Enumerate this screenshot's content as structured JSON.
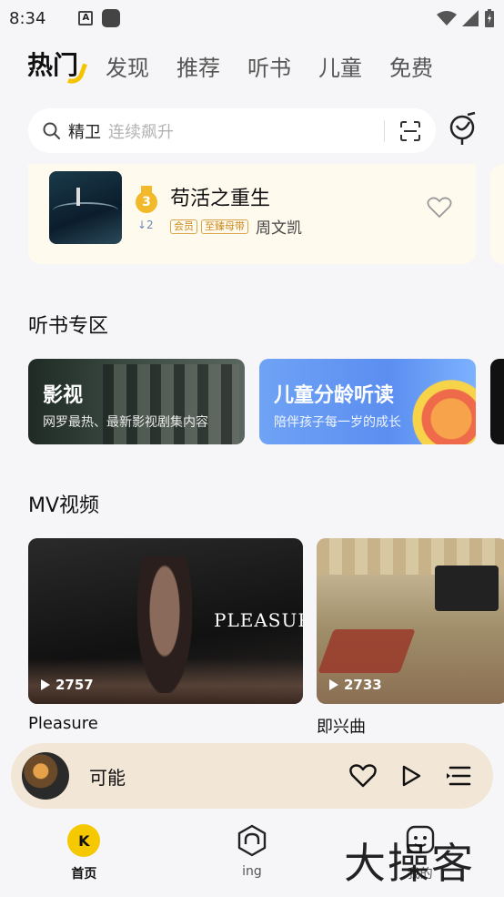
{
  "status_bar": {
    "time": "8:34",
    "notif_icon_a": "A"
  },
  "tabs": [
    "热门",
    "发现",
    "推荐",
    "听书",
    "儿童",
    "免费"
  ],
  "search": {
    "query": "精卫",
    "hint": "连续飙升"
  },
  "top_item": {
    "rank": "3",
    "rank_change": "↓2",
    "title": "苟活之重生",
    "tags": [
      "会员",
      "至臻母带"
    ],
    "author": "周文凯"
  },
  "audiobook_section": {
    "title": "听书专区",
    "cards": [
      {
        "title": "影视",
        "subtitle": "网罗最热、最新影视剧集内容"
      },
      {
        "title": "儿童分龄听读",
        "subtitle": "陪伴孩子每一岁的成长"
      }
    ]
  },
  "mv_section": {
    "title": "MV视频",
    "items": [
      {
        "title": "Pleasure",
        "plays": "2757",
        "logo": "PLEASURE"
      },
      {
        "title": "即兴曲",
        "plays": "2733"
      }
    ]
  },
  "mini_player": {
    "title": "可能"
  },
  "bottom_nav": [
    {
      "label": "首页",
      "active": true,
      "icon_text": "K"
    },
    {
      "label": "ing",
      "active": false
    },
    {
      "label": "我的",
      "active": false
    }
  ],
  "watermark": "大操客",
  "colors": {
    "accent": "#f5c800",
    "background": "#f6f6f8",
    "player_bg": "#f2e6d6"
  }
}
